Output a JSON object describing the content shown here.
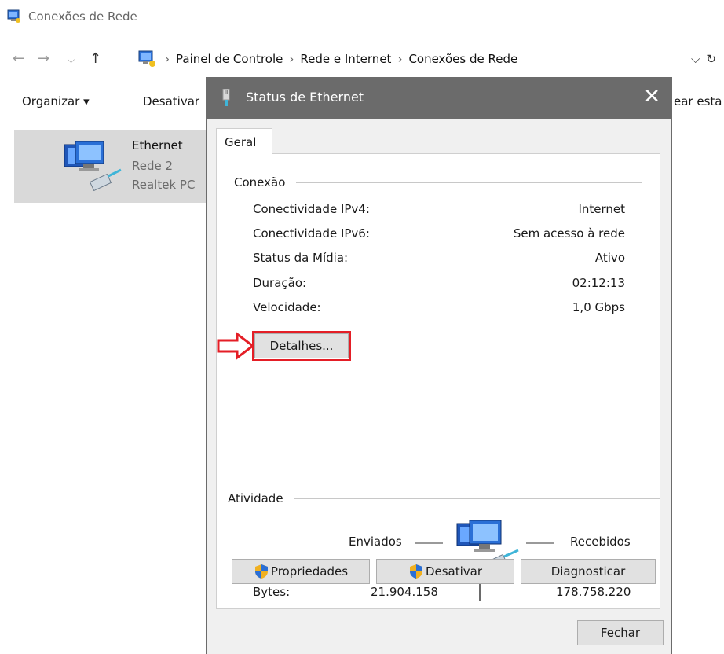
{
  "window": {
    "title": "Conexões de Rede",
    "breadcrumb": [
      "Painel de Controle",
      "Rede e Internet",
      "Conexões de Rede"
    ]
  },
  "toolbar": {
    "organize": "Organizar ▾",
    "disable": "Desativar",
    "create": "ear esta"
  },
  "file_item": {
    "name": "Ethernet",
    "network": "Rede  2",
    "adapter": "Realtek PC"
  },
  "dialog": {
    "title": "Status de Ethernet",
    "tab": "Geral",
    "connection": {
      "section": "Conexão",
      "rows": [
        {
          "label": "Conectividade IPv4:",
          "value": "Internet"
        },
        {
          "label": "Conectividade IPv6:",
          "value": "Sem acesso à rede"
        },
        {
          "label": "Status da Mídia:",
          "value": "Ativo"
        },
        {
          "label": "Duração:",
          "value": "02:12:13"
        },
        {
          "label": "Velocidade:",
          "value": "1,0 Gbps"
        }
      ],
      "details_button": "Detalhes..."
    },
    "activity": {
      "section": "Atividade",
      "sent": "Enviados",
      "received": "Recebidos",
      "bytes_label": "Bytes:",
      "bytes_sent": "21.904.158",
      "bytes_received": "178.758.220"
    },
    "buttons": {
      "properties": "Propriedades",
      "disable": "Desativar",
      "diagnose": "Diagnosticar",
      "close": "Fechar"
    }
  },
  "colors": {
    "titlebar": "#6b6b6b",
    "highlight": "#e41e26",
    "selection": "#d9d9d9"
  }
}
